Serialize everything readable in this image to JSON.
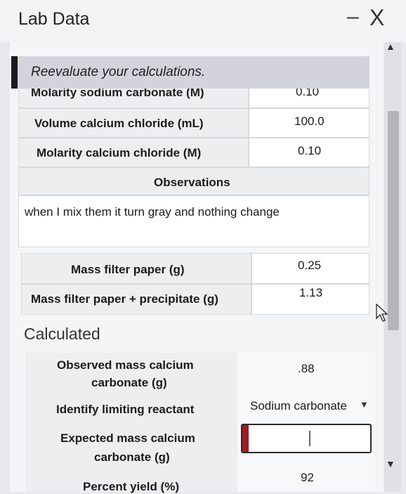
{
  "window": {
    "title": "Lab Data",
    "minimize_glyph": "–",
    "close_glyph": "X"
  },
  "feedback": {
    "message": "Reevaluate your calculations."
  },
  "reagents": [
    {
      "label": "Molarity sodium carbonate (M)",
      "value": "0.10"
    },
    {
      "label": "Volume calcium chloride (mL)",
      "value": "100.0"
    },
    {
      "label": "Molarity calcium chloride (M)",
      "value": "0.10"
    }
  ],
  "observations": {
    "header": "Observations",
    "text": "when I mix them it turn gray and nothing change"
  },
  "masses": [
    {
      "label": "Mass filter paper (g)",
      "value": "0.25"
    },
    {
      "label": "Mass filter paper + precipitate (g)",
      "value": "1.13"
    }
  ],
  "calculated": {
    "heading": "Calculated",
    "observed_mass_label_1": "Observed mass calcium",
    "observed_mass_label_2": "carbonate (g)",
    "observed_mass_value": ".88",
    "limiting_label": "Identify limiting reactant",
    "limiting_value": "Sodium carbonate",
    "expected_mass_label_1": "Expected mass calcium",
    "expected_mass_label_2": "carbonate (g)",
    "expected_mass_value": "",
    "percent_yield_label": "Percent yield (%)",
    "percent_yield_value": "92"
  },
  "colors": {
    "invalid_flag": "#9e1c22",
    "feedback_bg": "#d2d3dc",
    "feedback_bar": "#1a1a1a"
  },
  "icons": [
    "minimize-icon",
    "close-icon",
    "chevron-down-icon",
    "scroll-up-arrow-icon",
    "scroll-down-arrow-icon",
    "mouse-pointer-icon"
  ]
}
